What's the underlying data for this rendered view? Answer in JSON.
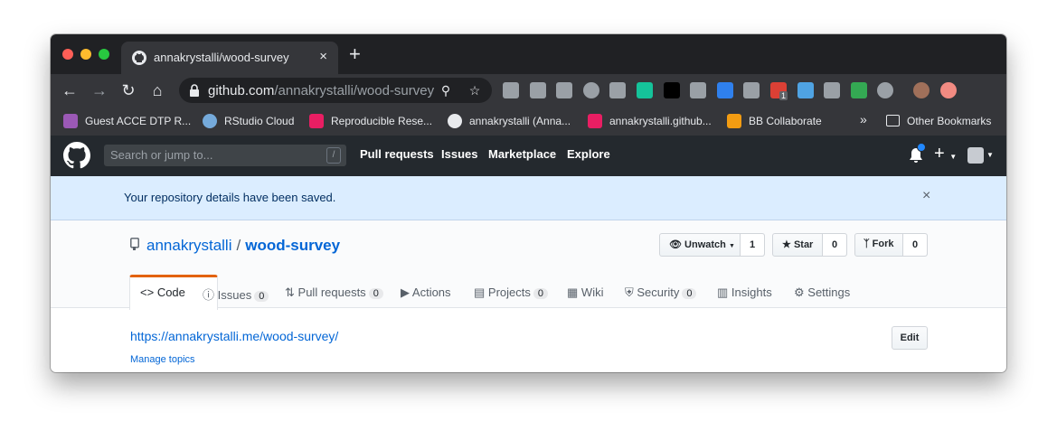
{
  "browser": {
    "tab_title": "annakrystalli/wood-survey",
    "tab_close": "×",
    "new_tab": "+",
    "url_host": "github.com",
    "url_path": "/annakrystalli/wood-survey",
    "extensions": [
      {
        "name": "ublock-icon",
        "color": "#9aa0a6"
      },
      {
        "name": "dropbox-icon",
        "color": "#9aa0a6"
      },
      {
        "name": "h-icon",
        "color": "#9aa0a6"
      },
      {
        "name": "globe-icon",
        "color": "#9aa0a6"
      },
      {
        "name": "b-icon",
        "color": "#9aa0a6"
      },
      {
        "name": "grammarly-icon",
        "color": "#15c39a"
      },
      {
        "name": "lock-ext-icon",
        "color": "#000000"
      },
      {
        "name": "lens-icon",
        "color": "#9aa0a6"
      },
      {
        "name": "shield-ext-icon",
        "color": "#2f80ed"
      },
      {
        "name": "google-icon",
        "color": "#9aa0a6"
      },
      {
        "name": "todo-icon",
        "color": "#db4035"
      },
      {
        "name": "pen-icon",
        "color": "#4fa3e3"
      },
      {
        "name": "m-icon",
        "color": "#9aa0a6"
      },
      {
        "name": "google-multi-icon",
        "color": "#34a853"
      },
      {
        "name": "circle-ext-icon",
        "color": "#9aa0a6"
      },
      {
        "name": "profile-icon",
        "color": "#a0705a"
      },
      {
        "name": "update-icon",
        "color": "#f28b82"
      }
    ],
    "todo_badge": "1"
  },
  "bookmarks": {
    "items": [
      {
        "label": "Guest ACCE DTP R...",
        "color": "#9b59b6"
      },
      {
        "label": "RStudio Cloud",
        "color": "#75aadb"
      },
      {
        "label": "Reproducible Rese...",
        "color": "#e91e63"
      },
      {
        "label": "annakrystalli (Anna...",
        "color": "#e8eaed"
      },
      {
        "label": "annakrystalli.github...",
        "color": "#e91e63"
      },
      {
        "label": "BB Collaborate",
        "color": "#f39c12"
      }
    ],
    "more": "»",
    "other": "Other Bookmarks"
  },
  "github": {
    "search_placeholder": "Search or jump to...",
    "search_key": "/",
    "nav": [
      "Pull requests",
      "Issues",
      "Marketplace",
      "Explore"
    ],
    "plus": "+",
    "flash": "Your repository details have been saved.",
    "flash_close": "×",
    "owner": "annakrystalli",
    "separator": "/",
    "repo": "wood-survey",
    "watch_label": "Unwatch",
    "watch_count": "1",
    "star_label": "Star",
    "star_count": "0",
    "fork_label": "Fork",
    "fork_count": "0",
    "tabs": [
      {
        "label": "Code",
        "count": ""
      },
      {
        "label": "Issues",
        "count": "0"
      },
      {
        "label": "Pull requests",
        "count": "0"
      },
      {
        "label": "Actions",
        "count": ""
      },
      {
        "label": "Projects",
        "count": "0"
      },
      {
        "label": "Wiki",
        "count": ""
      },
      {
        "label": "Security",
        "count": "0"
      },
      {
        "label": "Insights",
        "count": ""
      },
      {
        "label": "Settings",
        "count": ""
      }
    ],
    "homepage": "https://annakrystalli.me/wood-survey/",
    "edit": "Edit",
    "manage_topics": "Manage topics"
  }
}
